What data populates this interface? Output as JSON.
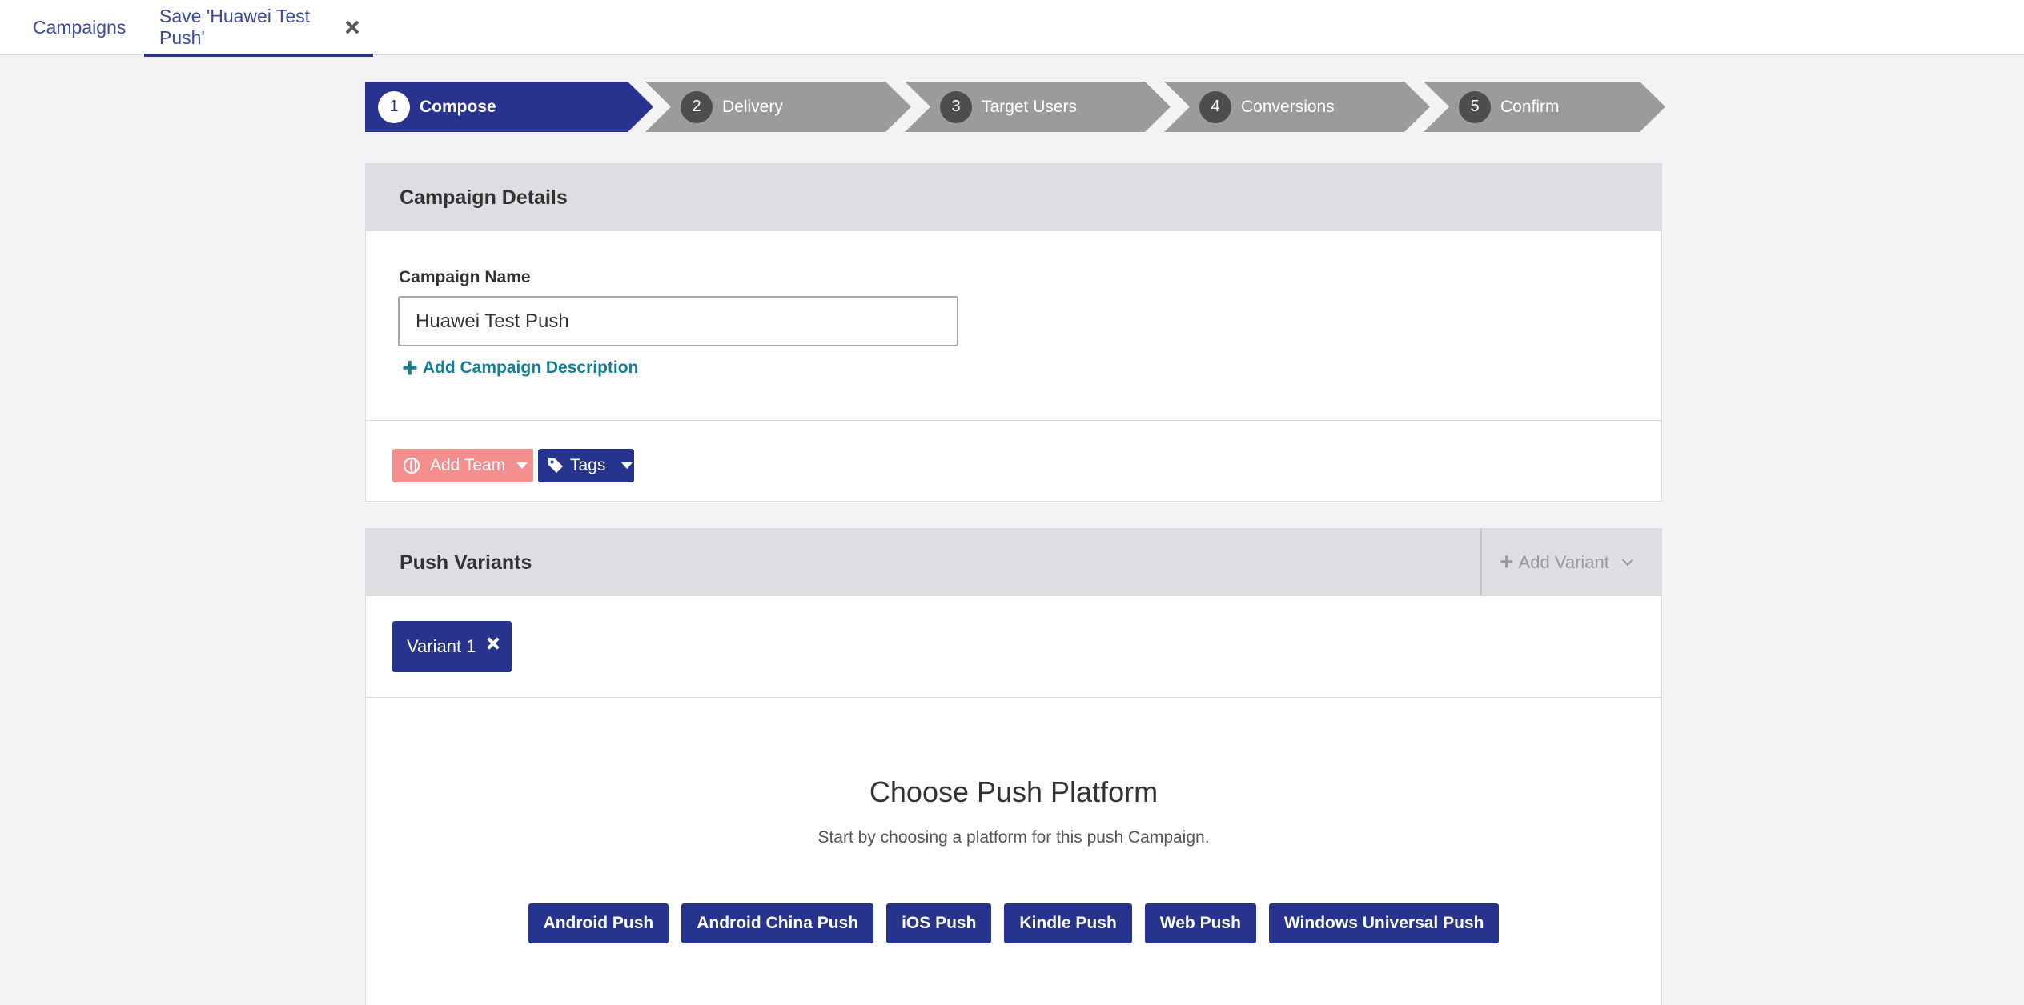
{
  "tabs": [
    {
      "label": "Campaigns"
    },
    {
      "label": "Save 'Huawei Test Push'"
    }
  ],
  "steps": [
    {
      "num": "1",
      "label": "Compose",
      "active": true
    },
    {
      "num": "2",
      "label": "Delivery"
    },
    {
      "num": "3",
      "label": "Target Users"
    },
    {
      "num": "4",
      "label": "Conversions"
    },
    {
      "num": "5",
      "label": "Confirm"
    }
  ],
  "campaign_details": {
    "title": "Campaign Details",
    "name_label": "Campaign Name",
    "name_value": "Huawei Test Push",
    "add_description": "Add Campaign Description",
    "add_team": "Add Team",
    "tags": "Tags"
  },
  "push_variants": {
    "title": "Push Variants",
    "add_variant": "Add Variant",
    "variant_label": "Variant 1",
    "choose_title": "Choose Push Platform",
    "choose_subtitle": "Start by choosing a platform for this push Campaign.",
    "platforms": [
      "Android Push",
      "Android China Push",
      "iOS Push",
      "Kindle Push",
      "Web Push",
      "Windows Universal Push"
    ]
  },
  "colors": {
    "active_step": "#27338e",
    "inactive_step": "#9b9b9e",
    "primary_button": "#27348d",
    "team_button": "#f3908f",
    "link": "#127f94"
  }
}
